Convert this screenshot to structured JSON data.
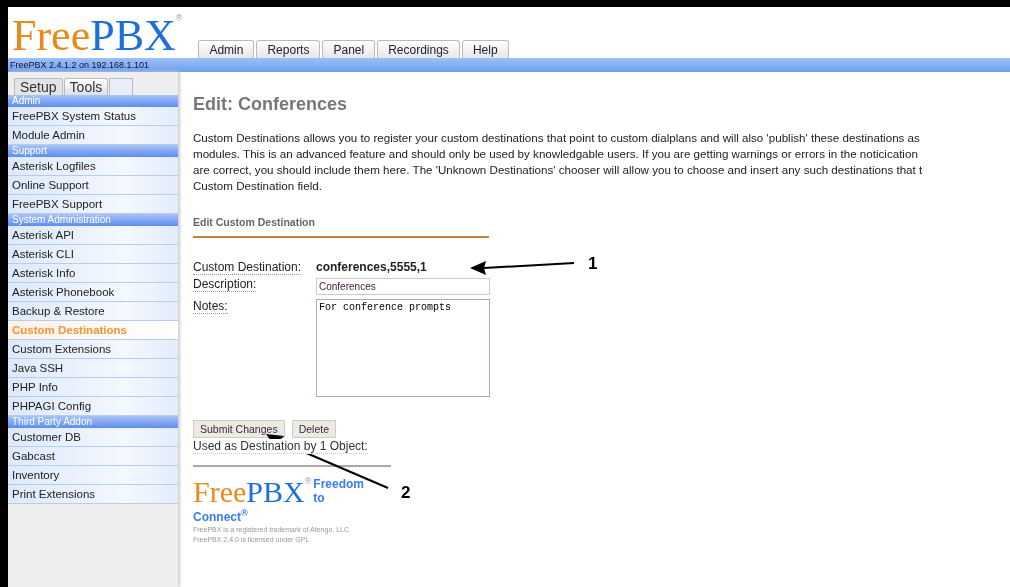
{
  "logo": {
    "first": "Free",
    "second": "PBX",
    "mark": "®"
  },
  "top_tabs": [
    "Admin",
    "Reports",
    "Panel",
    "Recordings",
    "Help"
  ],
  "version": "FreePBX 2.4.1.2 on 192.168.1.101",
  "sidebar": {
    "tabs": [
      {
        "label": "Setup",
        "selected": false
      },
      {
        "label": "Tools",
        "selected": true
      }
    ],
    "items": [
      {
        "kind": "header",
        "label": "Admin"
      },
      {
        "kind": "link",
        "label": "FreePBX System Status",
        "selected": false
      },
      {
        "kind": "link",
        "label": "Module Admin",
        "selected": false
      },
      {
        "kind": "header",
        "label": "Support"
      },
      {
        "kind": "link",
        "label": "Asterisk Logfiles",
        "selected": false
      },
      {
        "kind": "link",
        "label": "Online Support",
        "selected": false
      },
      {
        "kind": "link",
        "label": "FreePBX Support",
        "selected": false
      },
      {
        "kind": "header",
        "label": "System Administration"
      },
      {
        "kind": "link",
        "label": "Asterisk API",
        "selected": false
      },
      {
        "kind": "link",
        "label": "Asterisk CLI",
        "selected": false
      },
      {
        "kind": "link",
        "label": "Asterisk Info",
        "selected": false
      },
      {
        "kind": "link",
        "label": "Asterisk Phonebook",
        "selected": false
      },
      {
        "kind": "link",
        "label": "Backup & Restore",
        "selected": false
      },
      {
        "kind": "link",
        "label": "Custom Destinations",
        "selected": true
      },
      {
        "kind": "link",
        "label": "Custom Extensions",
        "selected": false
      },
      {
        "kind": "link",
        "label": "Java SSH",
        "selected": false
      },
      {
        "kind": "link",
        "label": "PHP Info",
        "selected": false
      },
      {
        "kind": "link",
        "label": "PHPAGI Config",
        "selected": false
      },
      {
        "kind": "header",
        "label": "Third Party Addon"
      },
      {
        "kind": "link",
        "label": "Customer DB",
        "selected": false
      },
      {
        "kind": "link",
        "label": "Gabcast",
        "selected": false
      },
      {
        "kind": "link",
        "label": "Inventory",
        "selected": false
      },
      {
        "kind": "link",
        "label": "Print Extensions",
        "selected": false
      }
    ]
  },
  "content": {
    "title": "Edit: Conferences",
    "description": [
      "Custom Destinations allows you to register your custom destinations that point to custom dialplans and will also 'publish' these destinations as",
      "modules. This is an advanced feature and should only be used by knowledgable users. If you are getting warnings or errors in the noticication",
      "are correct, you should include them here. The 'Unknown Destinations' chooser will allow you to choose and insert any such destinations that t",
      "Custom Destination field."
    ],
    "section": "Edit Custom Destination",
    "destination": {
      "label": "Custom Destination:",
      "value": "conferences,5555,1"
    },
    "description_field": {
      "label": "Description:",
      "value": "Conferences"
    },
    "notes_field": {
      "label": "Notes:",
      "value": "For conference prompts"
    },
    "buttons": [
      "Submit Changes",
      "Delete"
    ],
    "usage": "Used as Destination by 1 Object:"
  },
  "footer": {
    "logo": {
      "first": "Free",
      "second": "PBX",
      "mark": "®"
    },
    "slogan": "Freedom to",
    "slogan_end": "Connect",
    "slogan_mark": "®",
    "legal": [
      "FreePBX is a registered trademark of Atengo, LLC.",
      "FreePBX 2.4.0 is licensed under GPL"
    ]
  },
  "annotations": [
    {
      "label": "1"
    },
    {
      "label": "2"
    }
  ]
}
